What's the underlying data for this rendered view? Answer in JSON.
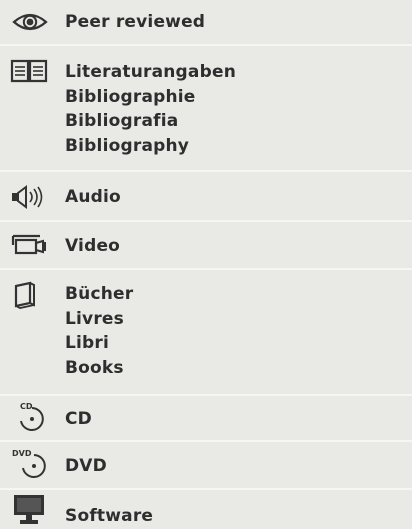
{
  "items": [
    {
      "icon": "eye-icon",
      "labels": [
        "Peer reviewed"
      ]
    },
    {
      "icon": "open-book-icon",
      "labels": [
        "Literaturangaben",
        "Bibliographie",
        "Bibliografia",
        "Bibliography"
      ]
    },
    {
      "icon": "speaker-icon",
      "labels": [
        "Audio"
      ]
    },
    {
      "icon": "video-camera-icon",
      "labels": [
        "Video"
      ]
    },
    {
      "icon": "book-icon",
      "labels": [
        "Bücher",
        "Livres",
        "Libri",
        "Books"
      ]
    },
    {
      "icon": "cd-icon",
      "labels": [
        "CD"
      ]
    },
    {
      "icon": "dvd-icon",
      "labels": [
        "DVD"
      ]
    },
    {
      "icon": "computer-monitor-icon",
      "labels": [
        "Software"
      ]
    }
  ],
  "icon_texts": {
    "cd": "CD",
    "dvd": "DVD"
  }
}
